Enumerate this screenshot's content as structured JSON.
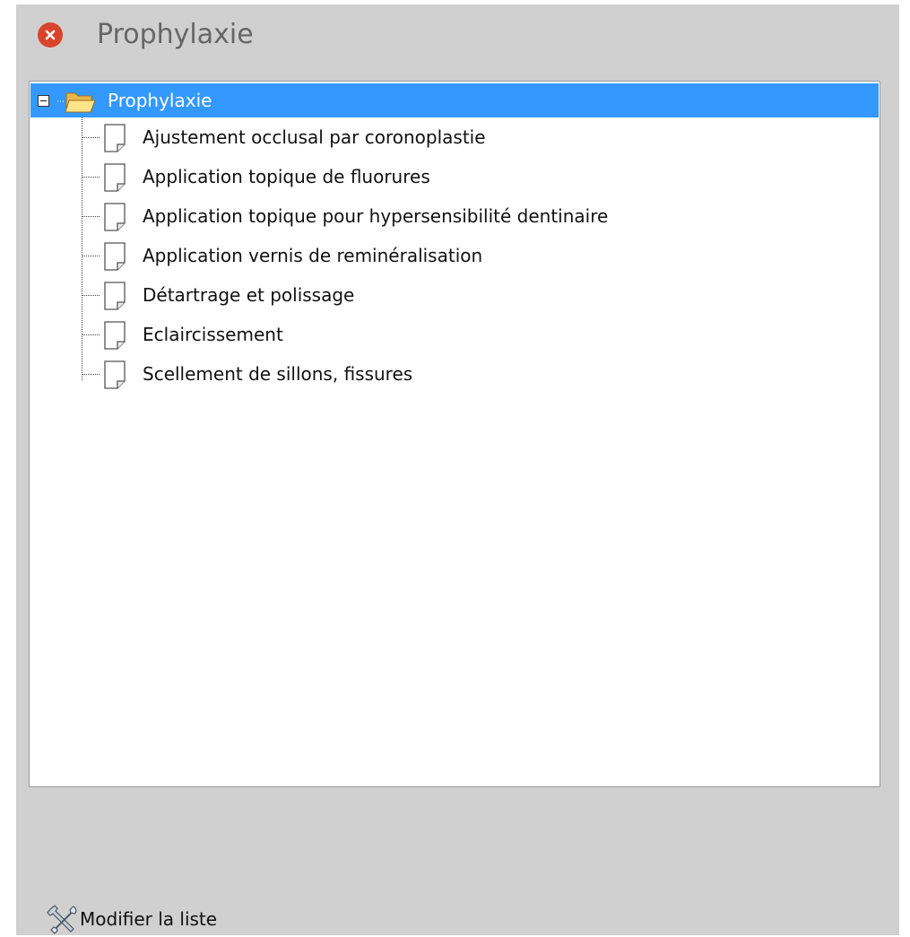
{
  "window": {
    "title": "Prophylaxie",
    "close_icon": "close-icon"
  },
  "tree": {
    "root": {
      "label": "Prophylaxie",
      "icon": "folder-open-icon",
      "expanded": true,
      "selected": true
    },
    "items": [
      {
        "label": "Ajustement occlusal par coronoplastie",
        "icon": "document-icon"
      },
      {
        "label": "Application topique de fluorures",
        "icon": "document-icon"
      },
      {
        "label": "Application topique pour hypersensibilité dentinaire",
        "icon": "document-icon"
      },
      {
        "label": "Application vernis de reminéralisation",
        "icon": "document-icon"
      },
      {
        "label": "Détartrage et polissage",
        "icon": "document-icon"
      },
      {
        "label": "Eclaircissement",
        "icon": "document-icon"
      },
      {
        "label": "Scellement de sillons, fissures",
        "icon": "document-icon"
      }
    ]
  },
  "footer": {
    "edit_list_label": "Modifier la liste",
    "icon": "tools-icon"
  },
  "colors": {
    "panel_bg": "#d0d0d0",
    "selection": "#3399ff",
    "close_button": "#d9442c",
    "title_text": "#666666"
  }
}
